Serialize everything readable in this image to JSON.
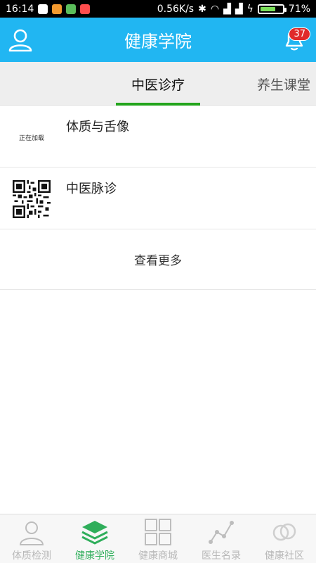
{
  "status_bar": {
    "time": "16:14",
    "network_speed": "0.56K/s",
    "battery_percent": "71%",
    "battery_level": 0.71
  },
  "header": {
    "title": "健康学院",
    "notification_count": "37"
  },
  "tabs": [
    {
      "label": "中医诊疗",
      "active": true
    },
    {
      "label": "养生课堂",
      "active": false
    }
  ],
  "list": {
    "items": [
      {
        "title": "体质与舌像",
        "thumb_text": "正在加载",
        "thumb": "loading-placeholder"
      },
      {
        "title": "中医脉诊",
        "thumb": "qr-code-icon"
      }
    ],
    "more_label": "查看更多"
  },
  "bottom_nav": [
    {
      "label": "体质检测",
      "icon": "person-icon",
      "active": false
    },
    {
      "label": "健康学院",
      "icon": "layers-icon",
      "active": true
    },
    {
      "label": "健康商城",
      "icon": "grid-icon",
      "active": false
    },
    {
      "label": "医生名录",
      "icon": "chart-line-icon",
      "active": false
    },
    {
      "label": "健康社区",
      "icon": "rings-icon",
      "active": false
    }
  ],
  "colors": {
    "header_bg": "#21b6f2",
    "tab_indicator": "#24a51d",
    "nav_active": "#2fae5b",
    "badge": "#e02a2a"
  }
}
